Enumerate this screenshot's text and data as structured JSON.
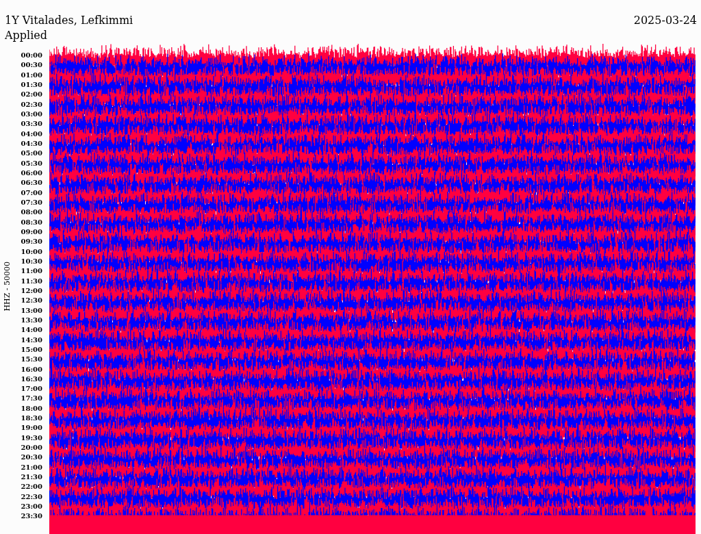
{
  "header": {
    "station": "1Y Vitalades, Lefkimmi",
    "date": "2025-03-24",
    "note": "Applied"
  },
  "axis_label": "HHZ - 50000",
  "time_labels": [
    "00:00",
    "00:30",
    "01:00",
    "01:30",
    "02:00",
    "02:30",
    "03:00",
    "03:30",
    "04:00",
    "04:30",
    "05:00",
    "05:30",
    "06:00",
    "06:30",
    "07:00",
    "07:30",
    "08:00",
    "08:30",
    "09:00",
    "09:30",
    "10:00",
    "10:30",
    "11:00",
    "11:30",
    "12:00",
    "12:30",
    "13:00",
    "13:30",
    "14:00",
    "14:30",
    "15:00",
    "15:30",
    "16:00",
    "16:30",
    "17:00",
    "17:30",
    "18:00",
    "18:30",
    "19:00",
    "19:30",
    "20:00",
    "20:30",
    "21:00",
    "21:30",
    "22:00",
    "22:30",
    "23:00",
    "23:30"
  ]
}
